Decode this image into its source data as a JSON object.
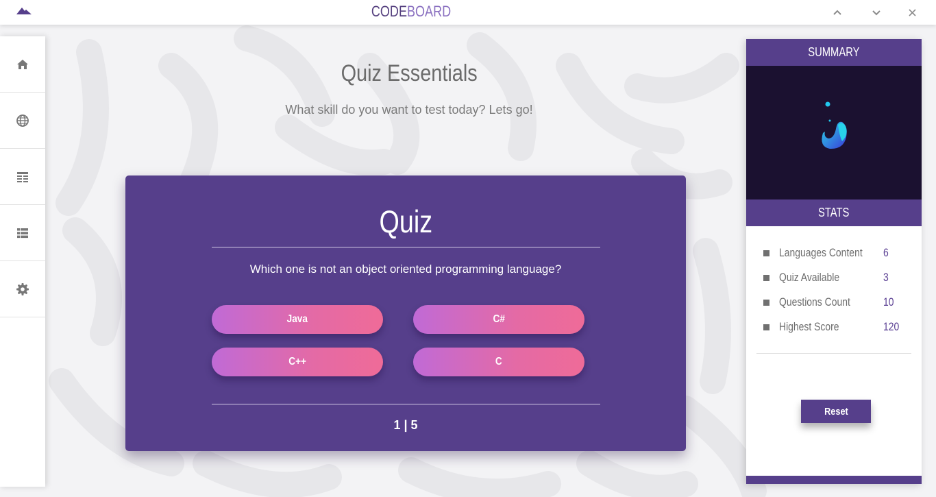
{
  "titlebar": {
    "title_part1": "CODE",
    "title_part2": "BOARD",
    "logo_icon": "mountain-logo-icon",
    "controls": [
      "chevron-up-icon",
      "chevron-down-icon",
      "close-icon"
    ]
  },
  "sidebar": {
    "items": [
      {
        "icon": "home-icon"
      },
      {
        "icon": "globe-icon"
      },
      {
        "icon": "table-icon"
      },
      {
        "icon": "list-icon"
      },
      {
        "icon": "gear-icon"
      }
    ]
  },
  "main": {
    "heading": "Quiz Essentials",
    "subheading": "What skill do you want to test today? Lets go!"
  },
  "quiz": {
    "title": "Quiz",
    "question": "Which one is not an object oriented programming language?",
    "answers": [
      "Java",
      "C#",
      "C++",
      "C"
    ],
    "progress": "1 | 5"
  },
  "panel": {
    "summary_label": "SUMMARY",
    "stats_label": "STATS",
    "stats": [
      {
        "label": "Languages Content",
        "value": "6"
      },
      {
        "label": "Quiz Available",
        "value": "3"
      },
      {
        "label": "Questions Count",
        "value": "10"
      },
      {
        "label": "Highest Score",
        "value": "120"
      }
    ],
    "reset_label": "Reset"
  },
  "colors": {
    "brand": "#563f8b",
    "gradient_start": "#c06ad6",
    "gradient_end": "#ef6b98",
    "background": "#f3f3f5"
  }
}
